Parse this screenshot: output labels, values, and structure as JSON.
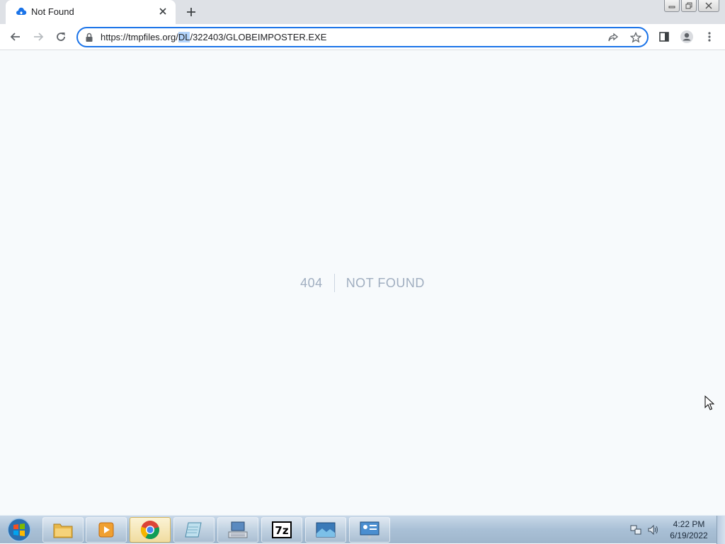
{
  "browser": {
    "tab": {
      "title": "Not Found",
      "favicon": "cloud-upload-icon"
    },
    "address_bar": {
      "url_before_sel": "https://tmpfiles.org/",
      "url_sel": "DL",
      "url_after_sel": "/322403/GLOBEIMPOSTER.EXE"
    },
    "accent_color": "#1a73e8"
  },
  "page": {
    "error_code": "404",
    "error_message": "NOT FOUND"
  },
  "taskbar": {
    "apps": [
      "windows-explorer-icon",
      "media-player-icon",
      "chrome-icon",
      "notepad-icon",
      "keyboard-monitor-icon",
      "7zip-icon",
      "photo-viewer-icon",
      "control-panel-icon"
    ],
    "app_7zip_label": "7z",
    "clock": {
      "time": "4:22 PM",
      "date": "6/19/2022"
    }
  }
}
